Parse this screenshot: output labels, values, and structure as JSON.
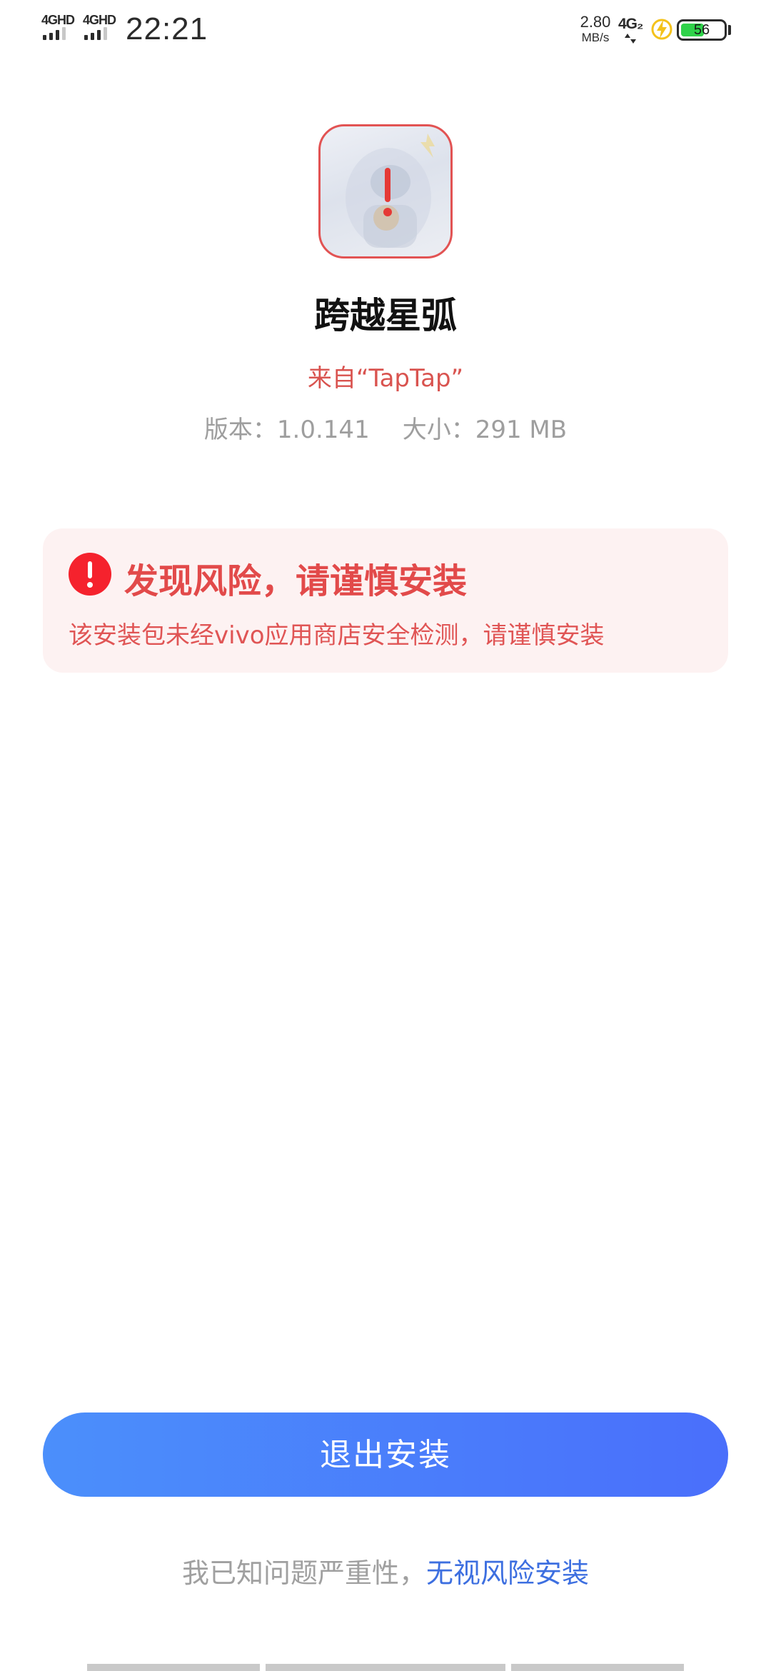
{
  "status_bar": {
    "sim1_label": "4GHD",
    "sim2_label": "4GHD",
    "time": "22:21",
    "net_speed_value": "2.80",
    "net_speed_unit": "MB/s",
    "net_type": "4G₂",
    "battery_level": "56",
    "battery_color": "#2fd24a",
    "charging_icon": "charging-bolt-icon"
  },
  "app": {
    "icon_status": "warning",
    "name": "跨越星弧",
    "source": "来自“TapTap”",
    "version": "版本：1.0.141",
    "size": "大小：291 MB"
  },
  "risk_card": {
    "icon": "warning-circle-icon",
    "title": "发现风险，请谨慎安装",
    "description": "该安装包未经vivo应用商店安全检测，请谨慎安装",
    "accent_color": "#e24a4a"
  },
  "actions": {
    "exit_label": "退出安装",
    "ignore_prefix": "我已知问题严重性，",
    "ignore_link_label": "无视风险安装",
    "primary_color": "#4a7cfb",
    "link_color": "#3d6fe0"
  }
}
